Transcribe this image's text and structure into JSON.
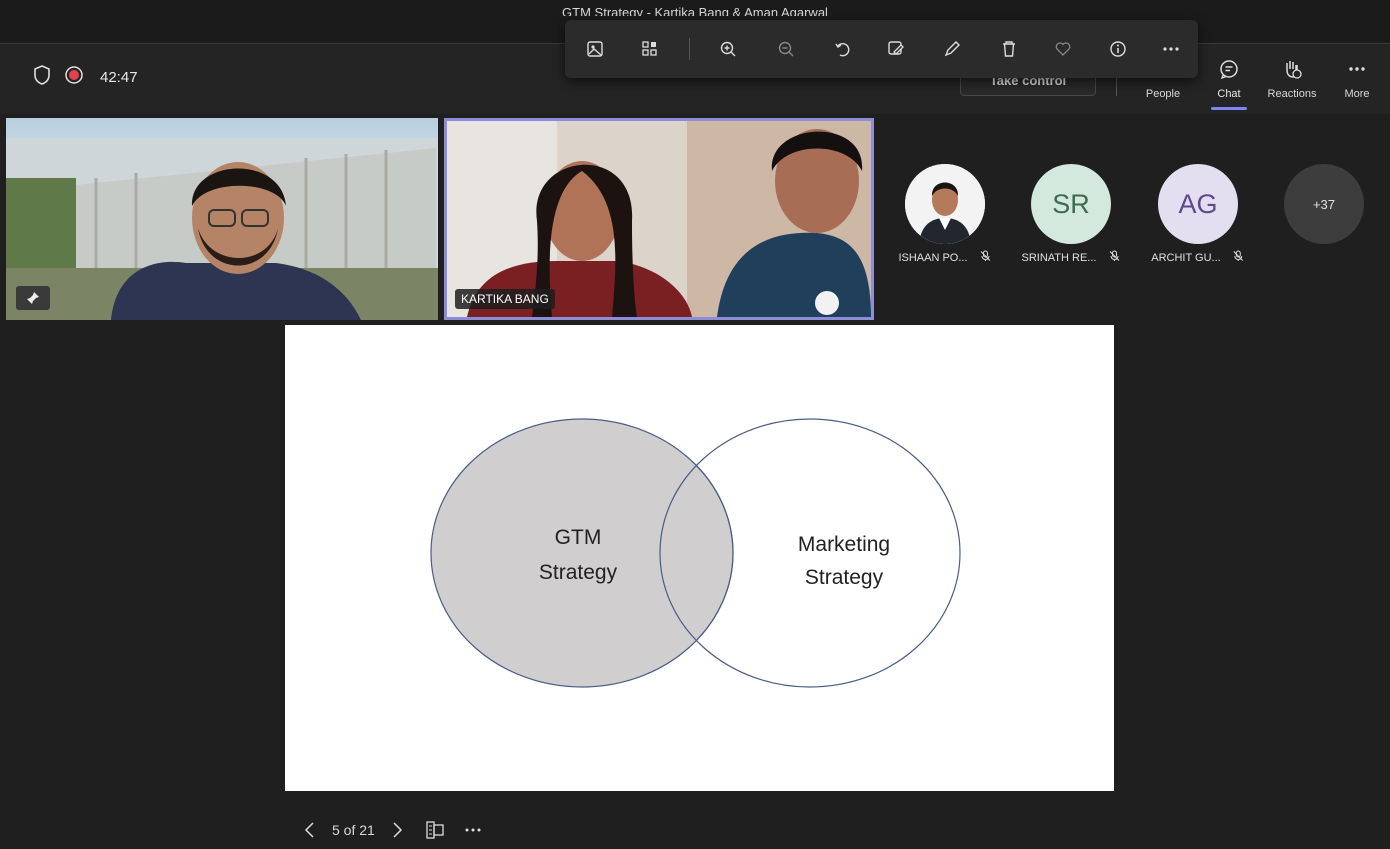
{
  "window": {
    "title": "GTM Strategy - Kartika Bang & Aman Agarwal"
  },
  "status": {
    "timer": "42:47"
  },
  "annotation_toolbar": {
    "icons": [
      "image-icon",
      "grid-icon",
      "zoom-in-icon",
      "zoom-out-icon",
      "rotate-icon",
      "edit-image-icon",
      "pen-icon",
      "delete-icon",
      "heart-icon",
      "info-icon",
      "more-icon"
    ]
  },
  "take_control": {
    "label": "Take control"
  },
  "nav": {
    "people": "People",
    "chat": "Chat",
    "reactions": "Reactions",
    "more": "More"
  },
  "videos": {
    "speaker2_name": "KARTIKA BANG"
  },
  "participants": [
    {
      "name": "ISHAAN PO...",
      "initials": "",
      "color": "#f0f0f0"
    },
    {
      "name": "SRINATH RE...",
      "initials": "SR",
      "color": "#d4e9dd",
      "text_color": "#3d6b50"
    },
    {
      "name": "ARCHIT GU...",
      "initials": "AG",
      "color": "#e4dff0",
      "text_color": "#5b4a8a"
    }
  ],
  "overflow_count": "+37",
  "slide": {
    "left_circle": [
      "GTM",
      "Strategy"
    ],
    "right_circle": [
      "Marketing",
      "Strategy"
    ]
  },
  "slide_nav": {
    "pages": "5 of 21"
  }
}
